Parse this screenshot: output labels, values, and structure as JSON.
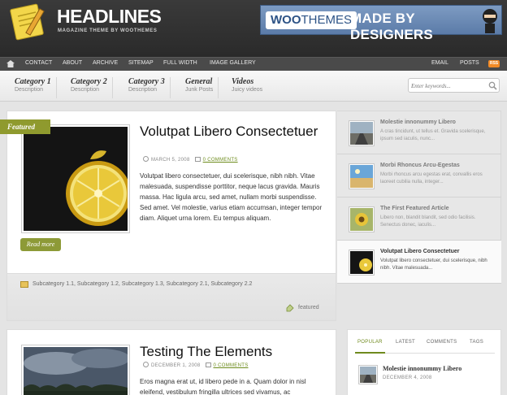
{
  "header": {
    "logo_title": "HEADLINES",
    "logo_subtitle": "MAGAZINE THEME BY WOOTHEMES",
    "banner": {
      "brand_left": "WOO",
      "brand_right": "THEMES",
      "tagline": "MADE BY DESIGNERS"
    }
  },
  "nav": {
    "left": [
      "CONTACT",
      "ABOUT",
      "ARCHIVE",
      "SITEMAP",
      "FULL WIDTH",
      "IMAGE GALLERY"
    ],
    "right": [
      "EMAIL",
      "POSTS"
    ],
    "rss_label": "RSS"
  },
  "categories": [
    {
      "title": "Category 1",
      "desc": "Description"
    },
    {
      "title": "Category 2",
      "desc": "Description"
    },
    {
      "title": "Category 3",
      "desc": "Description"
    },
    {
      "title": "General",
      "desc": "Junk Posts"
    },
    {
      "title": "Videos",
      "desc": "Juicy videos"
    }
  ],
  "search": {
    "placeholder": "Enter keywords..."
  },
  "featured": {
    "tab_label": "Featured",
    "title": "Volutpat Libero Consectetuer",
    "date": "MARCH 5, 2008",
    "comments": "0 COMMENTS",
    "body": "Volutpat libero consectetuer, dui scelerisque, nibh nibh. Vitae malesuada, suspendisse porttitor, neque lacus gravida. Mauris massa. Hac ligula arcu, sed amet, nullam morbi suspendisse. Sed amet. Vel molestie, varius etiam accumsan, integer tempor diam. Aliquet urna lorem. Eu tempus aliquam.",
    "read_more": "Read more",
    "subcategories": "Subcategory 1.1, Subcategory 1.2, Subcategory 1.3, Subcategory 2.1, Subcategory 2.2",
    "tag": "featured"
  },
  "featured_list": [
    {
      "title": "Molestie innonummy Libero",
      "desc": "A cras tincidunt, ut tellus et. Gravida scelerisque, ipsum sed iaculis, nunc..."
    },
    {
      "title": "Morbi Rhoncus Arcu-Egestas",
      "desc": "Morbi rhoncus arcu egestas erat, convallis eros laoreet cubilia nulla, integer..."
    },
    {
      "title": "The First Featured Article",
      "desc": "Libero non, blandit blandit, sed odio facilisis. Senectus donec, iaculis..."
    },
    {
      "title": "Volutpat Libero Consectetuer",
      "desc": "Volutpat libero consectetuer, dui scelerisque, nibh nibh. Vitae malesuada..."
    }
  ],
  "post2": {
    "title": "Testing The Elements",
    "date": "DECEMBER 1, 2008",
    "comments": "0 COMMENTS",
    "body": "Eros magna erat ut, id libero pede in a. Quam dolor in nisl eleifend, vestibulum fringilla ultrices sed vivamus, ac"
  },
  "widget": {
    "tabs": [
      "POPULAR",
      "LATEST",
      "COMMENTS",
      "TAGS"
    ],
    "item_title": "Molestie innonummy Libero",
    "item_date": "DECEMBER 4, 2008"
  },
  "colors": {
    "accent": "#8f9a2e",
    "link": "#6d8c1c",
    "rss": "#f28a25"
  }
}
